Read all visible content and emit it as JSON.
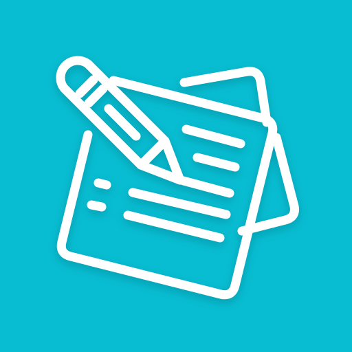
{
  "app_icon": {
    "name": "notes-with-pencil-icon",
    "colors": {
      "background": "#08BDD2",
      "stroke": "#FFFFFF",
      "shadow": "#00606C"
    }
  }
}
